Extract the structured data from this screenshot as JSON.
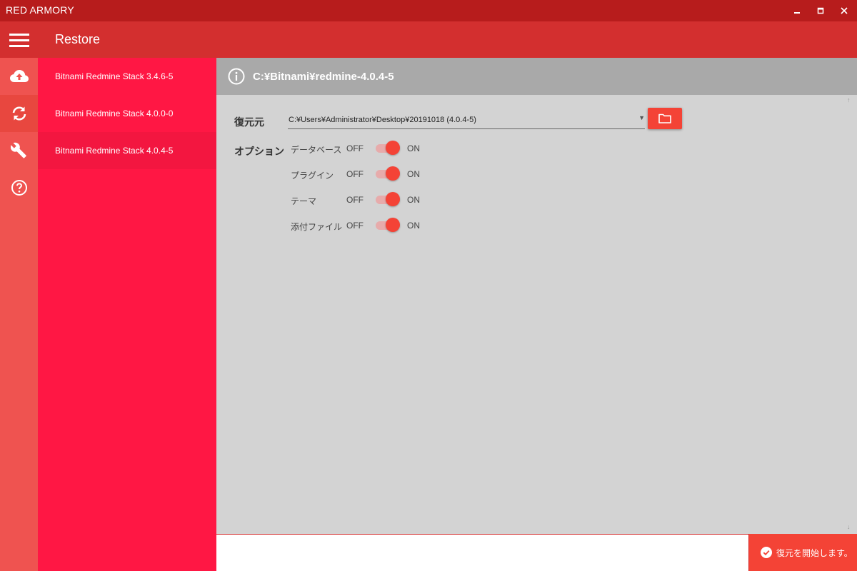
{
  "window": {
    "title": "RED ARMORY",
    "controls": [
      "minimize-icon",
      "maximize-icon",
      "close-icon"
    ]
  },
  "header": {
    "menu_icon": "hamburger-icon",
    "title": "Restore"
  },
  "rail": {
    "items": [
      {
        "icon": "cloud-upload-icon"
      },
      {
        "icon": "sync-icon",
        "active": true
      },
      {
        "icon": "wrench-icon"
      },
      {
        "icon": "help-icon"
      }
    ]
  },
  "projects": {
    "items": [
      {
        "label": "Bitnami Redmine Stack 3.4.6-5"
      },
      {
        "label": "Bitnami Redmine Stack 4.0.0-0"
      },
      {
        "label": "Bitnami Redmine Stack 4.0.4-5",
        "selected": true
      }
    ]
  },
  "main": {
    "info_icon": "info-icon",
    "path": "C:¥Bitnami¥redmine-4.0.4-5",
    "source_label": "復元元",
    "source_value": "C:¥Users¥Administrator¥Desktop¥20191018 (4.0.4-5)",
    "folder_icon": "folder-icon",
    "options_label": "オプション",
    "options": [
      {
        "name": "データベース",
        "off": "OFF",
        "on": "ON",
        "enabled": true
      },
      {
        "name": "プラグイン",
        "off": "OFF",
        "on": "ON",
        "enabled": true
      },
      {
        "name": "テーマ",
        "off": "OFF",
        "on": "ON",
        "enabled": true
      },
      {
        "name": "添付ファイル",
        "off": "OFF",
        "on": "ON",
        "enabled": true
      }
    ]
  },
  "footer": {
    "start_icon": "check-circle-icon",
    "start_label": "復元を開始します。"
  },
  "colors": {
    "titlebar": "#b71c1c",
    "header": "#d32f2f",
    "rail": "#ef5350",
    "project_list": "#ff1744",
    "accent": "#f44336",
    "info_bar": "#a9a9a9",
    "panel": "#d3d3d3"
  }
}
